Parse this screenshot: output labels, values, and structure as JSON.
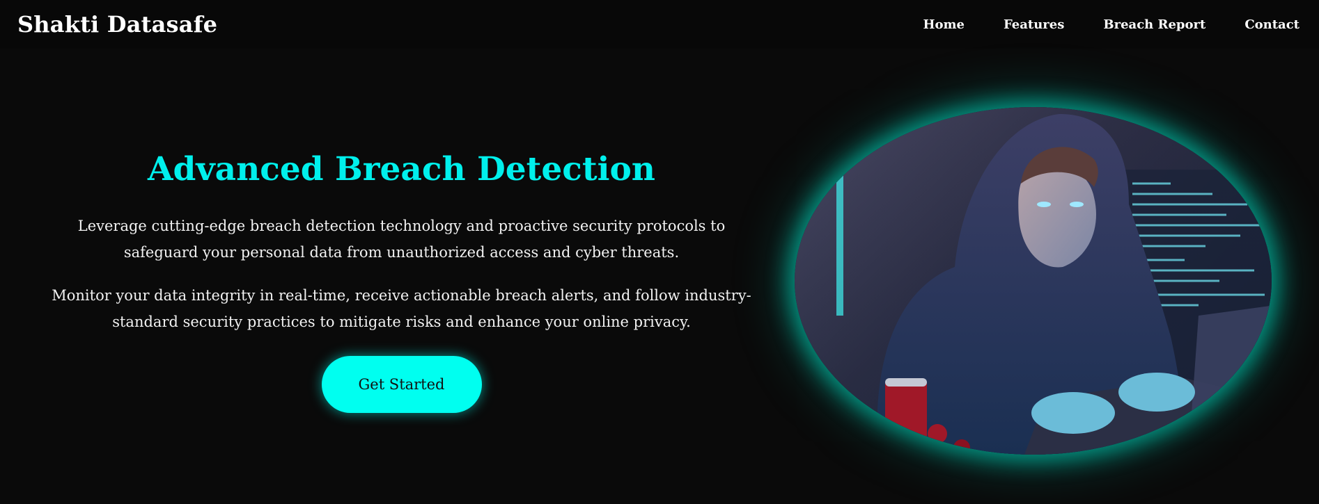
{
  "brand": "Shakti Datasafe",
  "nav": [
    "Home",
    "Features",
    "Breach Report",
    "Contact"
  ],
  "hero": {
    "title": "Advanced Breach Detection",
    "p1": "Leverage cutting-edge breach detection technology and proactive security protocols to safeguard your personal data from unauthorized access and cyber threats.",
    "p2": "Monitor your data integrity in real-time, receive actionable breach alerts, and follow industry-standard security practices to mitigate risks and enhance your online privacy.",
    "cta": "Get Started"
  },
  "colors": {
    "background": "#0a0a0a",
    "accent": "#00f0ec",
    "button": "#00fff0",
    "glow": "#00e6c8"
  }
}
